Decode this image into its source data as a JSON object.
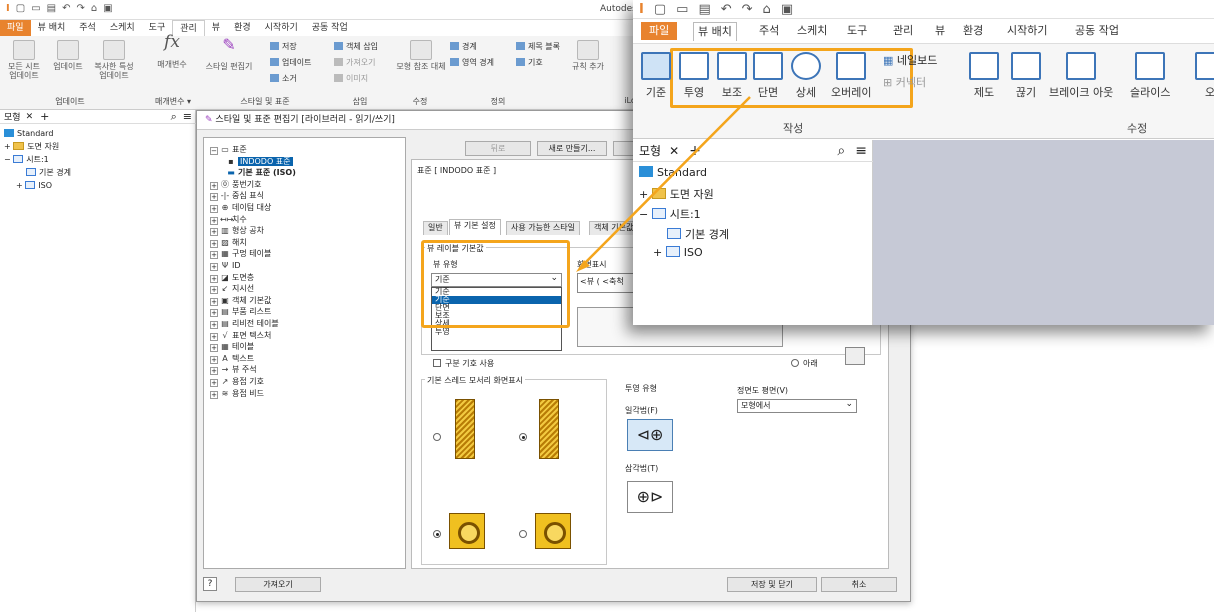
{
  "app": {
    "title_partial": "Autodes"
  },
  "back_menu": [
    "파일",
    "뷰 배치",
    "주석",
    "스케치",
    "도구",
    "관리",
    "뷰",
    "환경",
    "시작하기",
    "공동 작업"
  ],
  "back_menu_active": "관리",
  "back_ribbon": {
    "update_group": {
      "label": "업데이트",
      "buttons": [
        "모든 시트 업데이트",
        "업데이트",
        "복사한 특성 업데이트"
      ]
    },
    "params_group": {
      "label": "매개변수 ▾",
      "button": "매개변수"
    },
    "styles_group": {
      "label": "스타일 및 표준",
      "editor": "스타일 편집기",
      "save": "저장",
      "update": "업데이트",
      "purge": "소거"
    },
    "insert_group": {
      "label": "삽입",
      "object": "객체 삽입",
      "import": "가져오기",
      "image": "이미지"
    },
    "revise_group": {
      "label": "수정",
      "button": "모형 참조 대체"
    },
    "define_group": {
      "label": "정의",
      "border": "경계",
      "title_block": "제목 블록",
      "zone_border": "영역 경계",
      "symbol": "기호"
    },
    "rules_button": "규칙 추가",
    "ilogic_label": "iLo"
  },
  "left_pane": {
    "tab": "모형",
    "tree": [
      "Standard",
      "도면 자원",
      "시트:1",
      "기본 경계",
      "ISO"
    ]
  },
  "dialog": {
    "title": "스타일 및 표준 편집기 [라이브러리 - 읽기/쓰기]",
    "back_btn": "뒤로",
    "new_btn": "새로 만들기...",
    "save_btn": "저장",
    "header": "표준 [ INDODO 표준 ]",
    "tabs": [
      "일반",
      "뷰 기본 설정",
      "사용 가능한 스타일",
      "객체 기본값"
    ],
    "active_tab": "뷰 기본 설정",
    "section_view_defaults": "뷰 레이블 기본값",
    "view_type_label": "뷰 유형",
    "display_label": "화면표시",
    "view_type_value": "기준",
    "display_value_partial": "<뷰 ( <축척",
    "dropdown_options": [
      "기준",
      "기준",
      "단면",
      "보조",
      "상세",
      "투영"
    ],
    "dropdown_selected_index": 1,
    "use_delimiter": "구분 기호 사용",
    "below_label": "아래",
    "thread_section": "기본 스레드 모서리 화면표시",
    "projection_type": "투영 유형",
    "first_angle": "일각법(F)",
    "third_angle": "삼각법(T)",
    "front_plane_label": "정면도 평면(V)",
    "front_plane_value": "모형에서",
    "import_btn": "가져오기",
    "save_close_btn": "저장 및 닫기",
    "cancel_btn": "취소",
    "style_tree": [
      {
        "label": "표준",
        "expanded": true
      },
      {
        "label": "INDODO 표준",
        "selected": true
      },
      {
        "label": "기본 표준 (ISO)",
        "bold": true
      },
      {
        "label": "풍번기호"
      },
      {
        "label": "중심 표식"
      },
      {
        "label": "데이텀 대상"
      },
      {
        "label": "치수"
      },
      {
        "label": "형상 공차"
      },
      {
        "label": "해치"
      },
      {
        "label": "구멍 테이블"
      },
      {
        "label": "ID"
      },
      {
        "label": "도면층"
      },
      {
        "label": "지시선"
      },
      {
        "label": "객체 기본값"
      },
      {
        "label": "부품 리스트"
      },
      {
        "label": "리비전 테이블"
      },
      {
        "label": "표면 텍스처"
      },
      {
        "label": "테이블"
      },
      {
        "label": "텍스트"
      },
      {
        "label": "뷰 주석"
      },
      {
        "label": "용접 기호"
      },
      {
        "label": "용접 비드"
      }
    ]
  },
  "inset": {
    "menu": [
      "파일",
      "뷰 배치",
      "주석",
      "스케치",
      "도구",
      "관리",
      "뷰",
      "환경",
      "시작하기",
      "공동 작업"
    ],
    "menu_active": "뷰 배치",
    "create_buttons": [
      "기준",
      "투영",
      "보조",
      "단면",
      "상세",
      "오버레이"
    ],
    "other_buttons": {
      "nailboard": "네일보드",
      "connector": "커넥터",
      "drafting": "제도",
      "break": "끊기",
      "breakout": "브레이크 아웃",
      "slice": "슬라이스",
      "partial": "오"
    },
    "group_create": "작성",
    "group_modify": "수정",
    "pane_tab": "모형",
    "tree": [
      "Standard",
      "도면 자원",
      "시트:1",
      "기본 경계",
      "ISO"
    ]
  },
  "colors": {
    "accent_orange": "#f4a51c",
    "file_tab": "#e8832e",
    "selection_blue": "#0a64ad"
  }
}
